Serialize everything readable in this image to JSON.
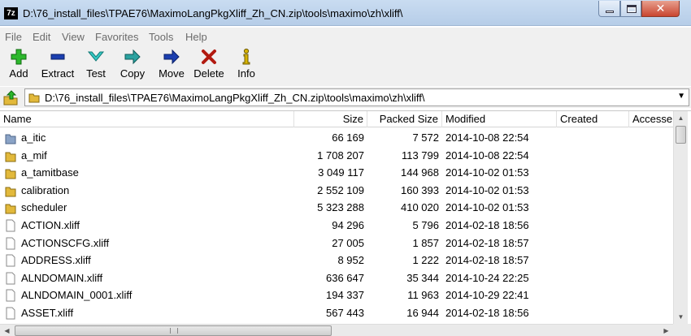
{
  "window": {
    "title": "D:\\76_install_files\\TPAE76\\MaximoLangPkgXliff_Zh_CN.zip\\tools\\maximo\\zh\\xliff\\",
    "app_icon_text": "7z",
    "close_glyph": "✕"
  },
  "menu": [
    "File",
    "Edit",
    "View",
    "Favorites",
    "Tools",
    "Help"
  ],
  "toolbar": {
    "add": "Add",
    "extract": "Extract",
    "test": "Test",
    "copy": "Copy",
    "move": "Move",
    "delete": "Delete",
    "info": "Info"
  },
  "address": {
    "path": "D:\\76_install_files\\TPAE76\\MaximoLangPkgXliff_Zh_CN.zip\\tools\\maximo\\zh\\xliff\\"
  },
  "columns": {
    "name": "Name",
    "size": "Size",
    "packed": "Packed Size",
    "modified": "Modified",
    "created": "Created",
    "accessed": "Accesse"
  },
  "rows": [
    {
      "name": "a_itic",
      "size": "66 169",
      "packed": "7 572",
      "modified": "2014-10-08 22:54",
      "type": "folder"
    },
    {
      "name": "a_mif",
      "size": "1 708 207",
      "packed": "113 799",
      "modified": "2014-10-08 22:54",
      "type": "folder"
    },
    {
      "name": "a_tamitbase",
      "size": "3 049 117",
      "packed": "144 968",
      "modified": "2014-10-02 01:53",
      "type": "folder"
    },
    {
      "name": "calibration",
      "size": "2 552 109",
      "packed": "160 393",
      "modified": "2014-10-02 01:53",
      "type": "folder"
    },
    {
      "name": "scheduler",
      "size": "5 323 288",
      "packed": "410 020",
      "modified": "2014-10-02 01:53",
      "type": "folder"
    },
    {
      "name": "ACTION.xliff",
      "size": "94 296",
      "packed": "5 796",
      "modified": "2014-02-18 18:56",
      "type": "file"
    },
    {
      "name": "ACTIONSCFG.xliff",
      "size": "27 005",
      "packed": "1 857",
      "modified": "2014-02-18 18:57",
      "type": "file"
    },
    {
      "name": "ADDRESS.xliff",
      "size": "8 952",
      "packed": "1 222",
      "modified": "2014-02-18 18:57",
      "type": "file"
    },
    {
      "name": "ALNDOMAIN.xliff",
      "size": "636 647",
      "packed": "35 344",
      "modified": "2014-10-24 22:25",
      "type": "file"
    },
    {
      "name": "ALNDOMAIN_0001.xliff",
      "size": "194 337",
      "packed": "11 963",
      "modified": "2014-10-29 22:41",
      "type": "file"
    },
    {
      "name": "ASSET.xliff",
      "size": "567 443",
      "packed": "16 944",
      "modified": "2014-02-18 18:56",
      "type": "file"
    }
  ]
}
